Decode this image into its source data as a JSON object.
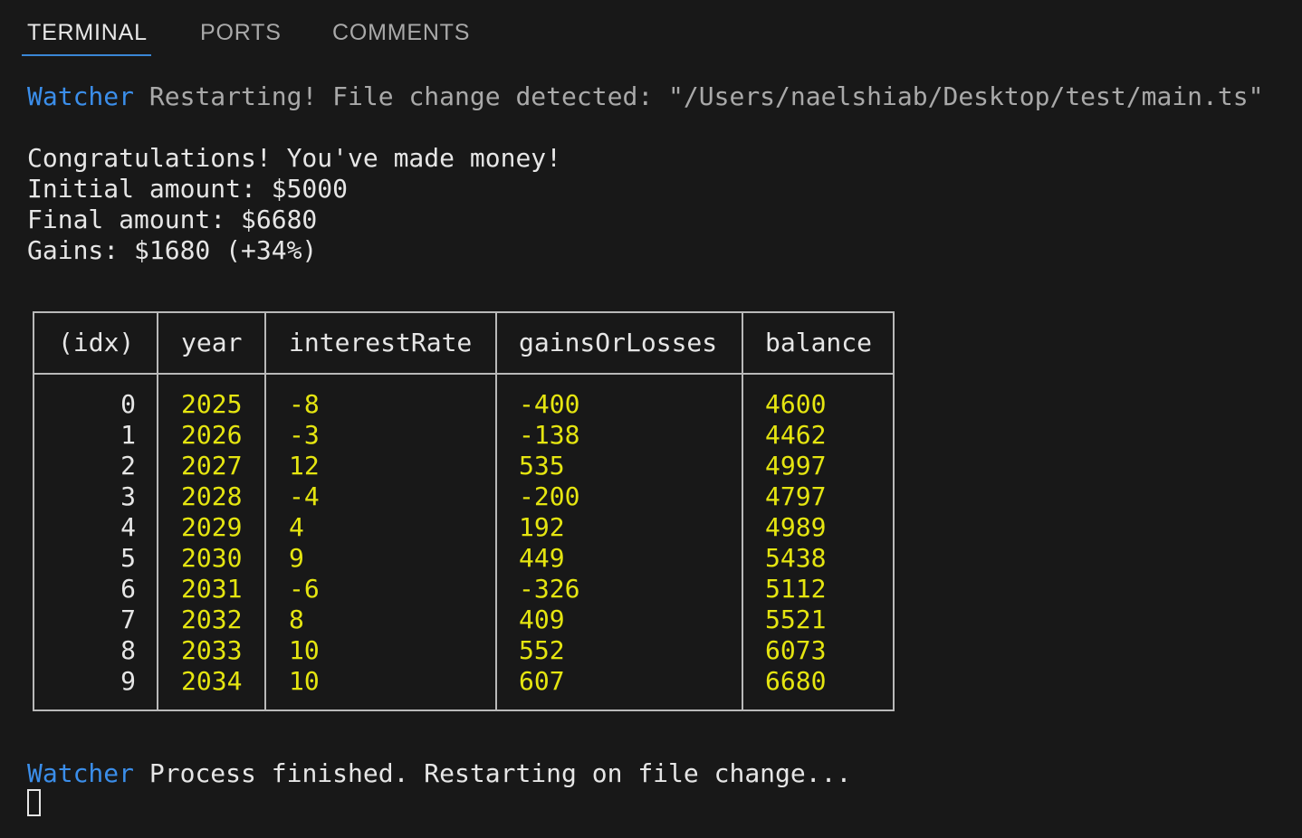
{
  "panel_tabs": [
    {
      "label": "TERMINAL",
      "active": true
    },
    {
      "label": "PORTS",
      "active": false
    },
    {
      "label": "COMMENTS",
      "active": false
    }
  ],
  "colors": {
    "background": "#181818",
    "accent": "#3a86d6",
    "watcher_label": "#3b8eea",
    "table_values": "#e5e510",
    "table_border": "#b9b9b9"
  },
  "terminal": {
    "watcher_restart": {
      "label": "Watcher",
      "message": "Restarting! File change detected: \"/Users/naelshiab/Desktop/test/main.ts\""
    },
    "summary_lines": [
      "Congratulations! You've made money!",
      "Initial amount: $5000",
      "Final amount: $6680",
      "Gains: $1680 (+34%)"
    ],
    "table": {
      "headers": [
        "(idx)",
        "year",
        "interestRate",
        "gainsOrLosses",
        "balance"
      ],
      "rows": [
        {
          "idx": "0",
          "year": "2025",
          "interestRate": "-8",
          "gainsOrLosses": "-400",
          "balance": "4600"
        },
        {
          "idx": "1",
          "year": "2026",
          "interestRate": "-3",
          "gainsOrLosses": "-138",
          "balance": "4462"
        },
        {
          "idx": "2",
          "year": "2027",
          "interestRate": "12",
          "gainsOrLosses": "535",
          "balance": "4997"
        },
        {
          "idx": "3",
          "year": "2028",
          "interestRate": "-4",
          "gainsOrLosses": "-200",
          "balance": "4797"
        },
        {
          "idx": "4",
          "year": "2029",
          "interestRate": "4",
          "gainsOrLosses": "192",
          "balance": "4989"
        },
        {
          "idx": "5",
          "year": "2030",
          "interestRate": "9",
          "gainsOrLosses": "449",
          "balance": "5438"
        },
        {
          "idx": "6",
          "year": "2031",
          "interestRate": "-6",
          "gainsOrLosses": "-326",
          "balance": "5112"
        },
        {
          "idx": "7",
          "year": "2032",
          "interestRate": "8",
          "gainsOrLosses": "409",
          "balance": "5521"
        },
        {
          "idx": "8",
          "year": "2033",
          "interestRate": "10",
          "gainsOrLosses": "552",
          "balance": "6073"
        },
        {
          "idx": "9",
          "year": "2034",
          "interestRate": "10",
          "gainsOrLosses": "607",
          "balance": "6680"
        }
      ]
    },
    "watcher_finished": {
      "label": "Watcher",
      "message": "Process finished. Restarting on file change..."
    }
  }
}
